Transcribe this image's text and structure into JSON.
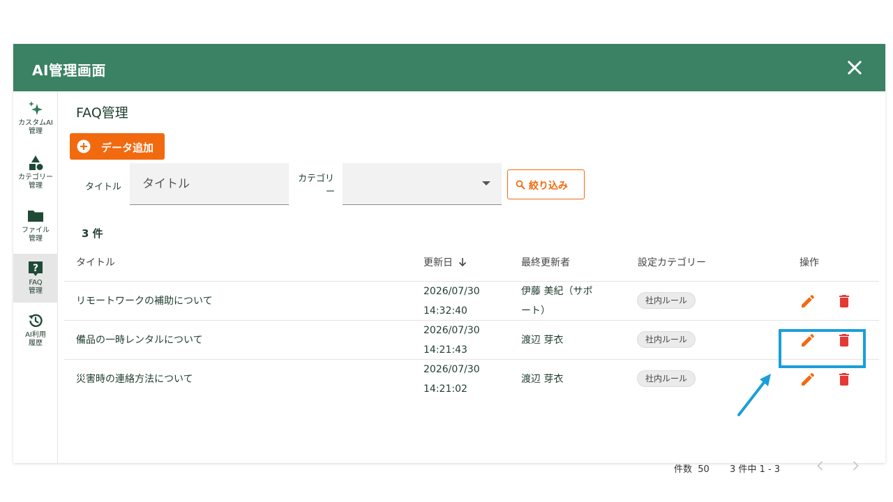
{
  "header": {
    "title": "AI管理画面"
  },
  "sidebar": {
    "items": [
      {
        "label": "カスタムAI\n管理",
        "icon": "sparkle-icon"
      },
      {
        "label": "カテゴリー\n管理",
        "icon": "shapes-icon"
      },
      {
        "label": "ファイル\n管理",
        "icon": "folder-icon"
      },
      {
        "label": "FAQ\n管理",
        "icon": "help-icon",
        "active": true
      },
      {
        "label": "AI利用\n履歴",
        "icon": "history-icon"
      }
    ]
  },
  "main": {
    "page_title": "FAQ管理",
    "add_button_label": "データ追加",
    "filter": {
      "title_label": "タイトル",
      "title_placeholder": "タイトル",
      "category_label_line1": "カテゴリ",
      "category_label_line2": "ー",
      "filter_button_label": "絞り込み"
    },
    "result_count": "3 件",
    "table": {
      "headers": {
        "title": "タイトル",
        "updated": "更新日",
        "updater": "最終更新者",
        "category": "設定カテゴリー",
        "actions": "操作"
      },
      "rows": [
        {
          "title": "リモートワークの補助について",
          "date": "2026/07/30",
          "time": "14:32:40",
          "updater_line1": "伊藤 美紀（サポ",
          "updater_line2": "ート）",
          "category": "社内ルール"
        },
        {
          "title": "備品の一時レンタルについて",
          "date": "2026/07/30",
          "time": "14:21:43",
          "updater_line1": "渡辺 芽衣",
          "updater_line2": "",
          "category": "社内ルール"
        },
        {
          "title": "災害時の連絡方法について",
          "date": "2026/07/30",
          "time": "14:21:02",
          "updater_line1": "渡辺 芽衣",
          "updater_line2": "",
          "category": "社内ルール"
        }
      ]
    },
    "footer": {
      "page_size_label": "件数",
      "page_size_value": "50",
      "range_text": "3 件中 1 - 3"
    }
  },
  "colors": {
    "header_bg": "#3b8164",
    "accent": "#f26a0f",
    "delete": "#e53935",
    "highlight": "#1a9fd8"
  }
}
